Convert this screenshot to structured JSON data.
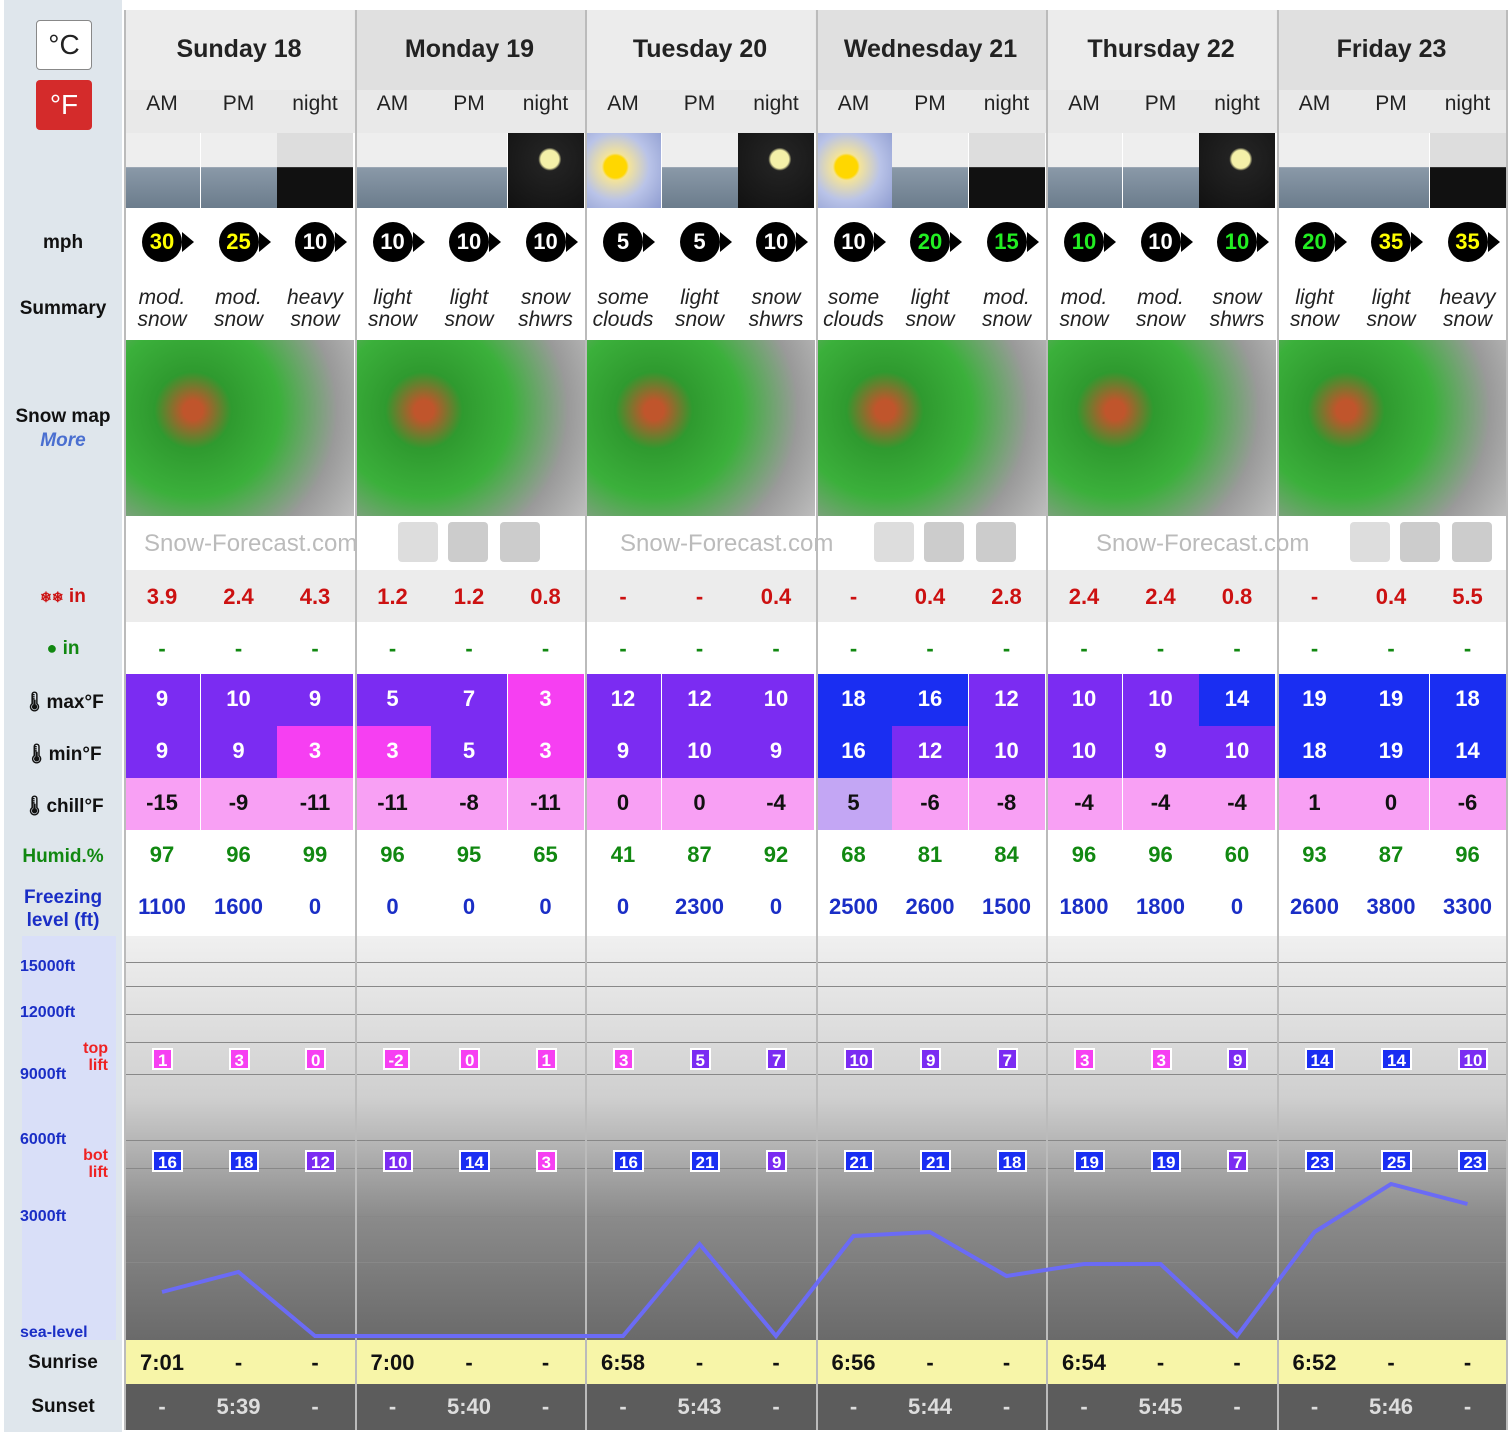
{
  "units": {
    "c": "°C",
    "f": "°F"
  },
  "labels": {
    "mph": "mph",
    "summary": "Summary",
    "snow_map": "Snow map",
    "more": "More",
    "snow_in": "in",
    "rain_in": "in",
    "max": "max°F",
    "min": "min°F",
    "chill": "chill°F",
    "humid": "Humid.%",
    "freezing": "Freezing level (ft)",
    "alt15": "15000ft",
    "alt12": "12000ft",
    "alt9": "9000ft",
    "alt6": "6000ft",
    "alt3": "3000ft",
    "sea": "sea-level",
    "top": "top",
    "bot": "bot",
    "lift": "lift",
    "sunrise": "Sunrise",
    "sunset": "Sunset"
  },
  "logo": "Snow-Forecast.com",
  "days": [
    "Sunday 18",
    "Monday 19",
    "Tuesday 20",
    "Wednesday 21",
    "Thursday 22",
    "Friday 23"
  ],
  "periods": [
    "AM",
    "PM",
    "night"
  ],
  "wind": [
    "30",
    "25",
    "10",
    "10",
    "10",
    "10",
    "5",
    "5",
    "10",
    "10",
    "20",
    "15",
    "10",
    "10",
    "10",
    "20",
    "35",
    "35"
  ],
  "wind_colors": [
    "#ffff00",
    "#ffff00",
    "#ffffff",
    "#ffffff",
    "#ffffff",
    "#ffffff",
    "#ffffff",
    "#ffffff",
    "#ffffff",
    "#ffffff",
    "#22ee22",
    "#22ee22",
    "#22ee22",
    "#ffffff",
    "#22ee22",
    "#22ee22",
    "#ffff00",
    "#ffff00"
  ],
  "summary": [
    [
      "mod.",
      "snow"
    ],
    [
      "mod.",
      "snow"
    ],
    [
      "heavy",
      "snow"
    ],
    [
      "light",
      "snow"
    ],
    [
      "light",
      "snow"
    ],
    [
      "snow",
      "shwrs"
    ],
    [
      "some",
      "clouds"
    ],
    [
      "light",
      "snow"
    ],
    [
      "snow",
      "shwrs"
    ],
    [
      "some",
      "clouds"
    ],
    [
      "light",
      "snow"
    ],
    [
      "mod.",
      "snow"
    ],
    [
      "mod.",
      "snow"
    ],
    [
      "mod.",
      "snow"
    ],
    [
      "snow",
      "shwrs"
    ],
    [
      "light",
      "snow"
    ],
    [
      "light",
      "snow"
    ],
    [
      "heavy",
      "snow"
    ]
  ],
  "snow": [
    "3.9",
    "2.4",
    "4.3",
    "1.2",
    "1.2",
    "0.8",
    "-",
    "-",
    "0.4",
    "-",
    "0.4",
    "2.8",
    "2.4",
    "2.4",
    "0.8",
    "-",
    "0.4",
    "5.5"
  ],
  "rain": [
    "-",
    "-",
    "-",
    "-",
    "-",
    "-",
    "-",
    "-",
    "-",
    "-",
    "-",
    "-",
    "-",
    "-",
    "-",
    "-",
    "-",
    "-"
  ],
  "max": [
    "9",
    "10",
    "9",
    "5",
    "7",
    "3",
    "12",
    "12",
    "10",
    "18",
    "16",
    "12",
    "10",
    "10",
    "14",
    "19",
    "19",
    "18"
  ],
  "min": [
    "9",
    "9",
    "3",
    "3",
    "5",
    "3",
    "9",
    "10",
    "9",
    "16",
    "12",
    "10",
    "10",
    "9",
    "10",
    "18",
    "19",
    "14"
  ],
  "chill": [
    "-15",
    "-9",
    "-11",
    "-11",
    "-8",
    "-11",
    "0",
    "0",
    "-4",
    "5",
    "-6",
    "-8",
    "-4",
    "-4",
    "-4",
    "1",
    "0",
    "-6"
  ],
  "humid": [
    "97",
    "96",
    "99",
    "96",
    "95",
    "65",
    "41",
    "87",
    "92",
    "68",
    "81",
    "84",
    "96",
    "96",
    "60",
    "93",
    "87",
    "96"
  ],
  "freezing": [
    "1100",
    "1600",
    "0",
    "0",
    "0",
    "0",
    "0",
    "2300",
    "0",
    "2500",
    "2600",
    "1500",
    "1800",
    "1800",
    "0",
    "2600",
    "3800",
    "3300"
  ],
  "top_lift": [
    "1",
    "3",
    "0",
    "-2",
    "0",
    "1",
    "3",
    "5",
    "7",
    "10",
    "9",
    "7",
    "3",
    "3",
    "9",
    "14",
    "14",
    "10"
  ],
  "bot_lift": [
    "16",
    "18",
    "12",
    "10",
    "14",
    "3",
    "16",
    "21",
    "9",
    "21",
    "21",
    "18",
    "19",
    "19",
    "7",
    "23",
    "25",
    "23"
  ],
  "sunrise": [
    "7:01",
    "-",
    "-",
    "7:00",
    "-",
    "-",
    "6:58",
    "-",
    "-",
    "6:56",
    "-",
    "-",
    "6:54",
    "-",
    "-",
    "6:52",
    "-",
    "-"
  ],
  "sunset": [
    "-",
    "5:39",
    "-",
    "-",
    "5:40",
    "-",
    "-",
    "5:43",
    "-",
    "-",
    "5:44",
    "-",
    "-",
    "5:45",
    "-",
    "-",
    "5:46",
    "-"
  ],
  "colors": {
    "purple": "#7b2cf2",
    "magenta": "#f63ff2",
    "blue": "#1a2ef2",
    "pink": "#f8a0f4",
    "lightpurple": "#c3a6f4",
    "snow_red": "#cc1111",
    "green": "#118811",
    "freeze_blue": "#1a2ec6"
  }
}
